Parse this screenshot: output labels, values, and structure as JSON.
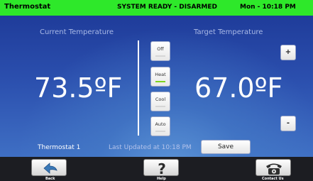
{
  "status_bar": {
    "title": "Thermostat",
    "system_status": "SYSTEM READY - DISARMED",
    "datetime": "Mon - 10:18 PM",
    "background_color": "#2ee82a"
  },
  "current": {
    "label": "Current Temperature",
    "value": "73.5ºF"
  },
  "target": {
    "label": "Target Temperature",
    "value": "67.0ºF",
    "increase_label": "+",
    "decrease_label": "-"
  },
  "modes": [
    {
      "label": "Off",
      "active": false
    },
    {
      "label": "Heat",
      "active": true
    },
    {
      "label": "Cool",
      "active": false
    },
    {
      "label": "Auto",
      "active": false
    }
  ],
  "active_mode_color": "#7dd321",
  "thermostat_name": "Thermostat 1",
  "last_updated": "Last Updated at 10:18 PM",
  "save_label": "Save",
  "footer": {
    "back": {
      "label": "Back",
      "icon": "back-arrow-icon"
    },
    "help": {
      "label": "Help",
      "icon": "question-mark-icon"
    },
    "contact": {
      "label": "Contact Us",
      "icon": "telephone-icon"
    }
  }
}
